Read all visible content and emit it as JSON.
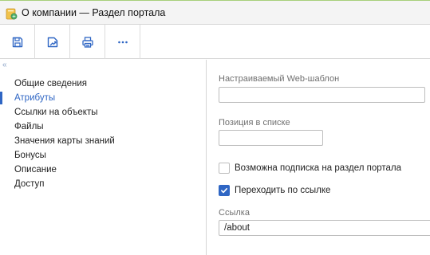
{
  "window": {
    "title": "О компании — Раздел портала",
    "accent_color": "#2f66c4"
  },
  "toolbar": {
    "buttons": [
      {
        "name": "save",
        "icon": "floppy-disk-icon"
      },
      {
        "name": "save-and-close",
        "icon": "save-close-icon"
      },
      {
        "name": "print",
        "icon": "printer-icon"
      },
      {
        "name": "more",
        "icon": "more-dots-icon"
      }
    ]
  },
  "sidebar": {
    "collapse_glyph": "«",
    "items": [
      {
        "label": "Общие сведения",
        "active": false
      },
      {
        "label": "Атрибуты",
        "active": true
      },
      {
        "label": "Ссылки на объекты",
        "active": false
      },
      {
        "label": "Файлы",
        "active": false
      },
      {
        "label": "Значения карты знаний",
        "active": false
      },
      {
        "label": "Бонусы",
        "active": false
      },
      {
        "label": "Описание",
        "active": false
      },
      {
        "label": "Доступ",
        "active": false
      }
    ]
  },
  "form": {
    "template_label": "Настраиваемый Web-шаблон",
    "template_value": "",
    "position_label": "Позиция в списке",
    "position_value": "",
    "subscribe_label": "Возможна подписка на раздел портала",
    "subscribe_checked": false,
    "follow_link_label": "Переходить по ссылке",
    "follow_link_checked": true,
    "link_label": "Ссылка",
    "link_value": "/about"
  }
}
